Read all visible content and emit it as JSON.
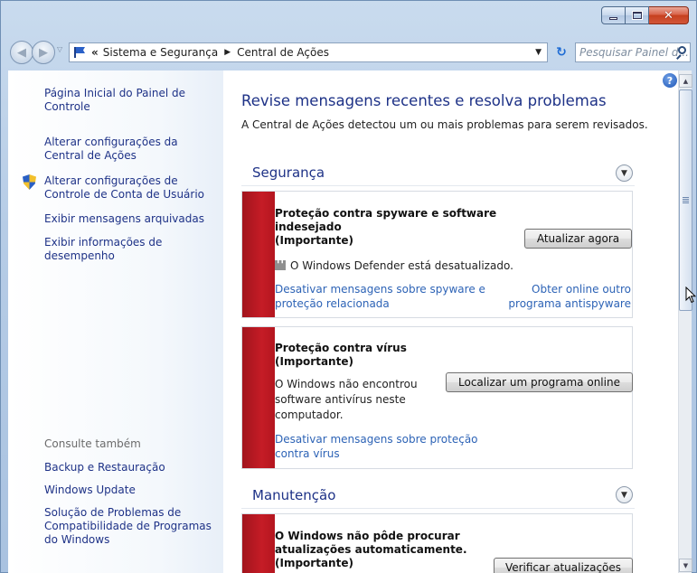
{
  "window": {
    "caption_buttons": [
      "minimize-icon",
      "maximize-icon",
      "close-icon"
    ]
  },
  "nav": {
    "back_icon": "back-arrow-icon",
    "forward_icon": "forward-arrow-icon",
    "breadcrumb": [
      "Sistema e Segurança",
      "Central de Ações"
    ],
    "overflow_marker": "«",
    "search_placeholder": "Pesquisar Painel d...",
    "refresh_glyph": "↻"
  },
  "left_pane": {
    "links": [
      "Página Inicial do Painel de Controle",
      "Alterar configurações da Central de Ações",
      "Alterar configurações de Controle de Conta de Usuário",
      "Exibir mensagens arquivadas",
      "Exibir informações de desempenho"
    ],
    "see_also_label": "Consulte também",
    "see_also": [
      "Backup e Restauração",
      "Windows Update",
      "Solução de Problemas de Compatibilidade de Programas do Windows"
    ]
  },
  "main": {
    "title": "Revise mensagens recentes e resolva problemas",
    "subtitle": "A Central de Ações detectou um ou mais problemas para serem revisados.",
    "sections": [
      {
        "title": "Segurança",
        "cards": [
          {
            "title_lines": [
              "Proteção contra spyware e software",
              "indesejado",
              "(Importante)"
            ],
            "button": "Atualizar agora",
            "status": "O Windows Defender está desatualizado.",
            "link_left": [
              "Desativar mensagens sobre spyware e",
              "proteção relacionada"
            ],
            "link_right": [
              "Obter online outro",
              "programa antispyware"
            ]
          },
          {
            "title_lines": [
              "Proteção contra vírus",
              "(Importante)"
            ],
            "button": "Localizar um programa online",
            "text_lines": [
              "O Windows não encontrou",
              "software antivírus neste",
              "computador."
            ],
            "link_left": [
              "Desativar mensagens sobre proteção",
              "contra vírus"
            ]
          }
        ]
      },
      {
        "title": "Manutenção",
        "cards": [
          {
            "title_lines": [
              "O Windows não pôde procurar",
              "atualizações automaticamente.",
              "(Importante)"
            ],
            "button": "Verificar atualizações"
          }
        ]
      }
    ]
  },
  "colors": {
    "link": "#1e3287",
    "card_link": "#2d63b6",
    "alert_bar": "#c51c26",
    "frame": "#b6cce6"
  }
}
